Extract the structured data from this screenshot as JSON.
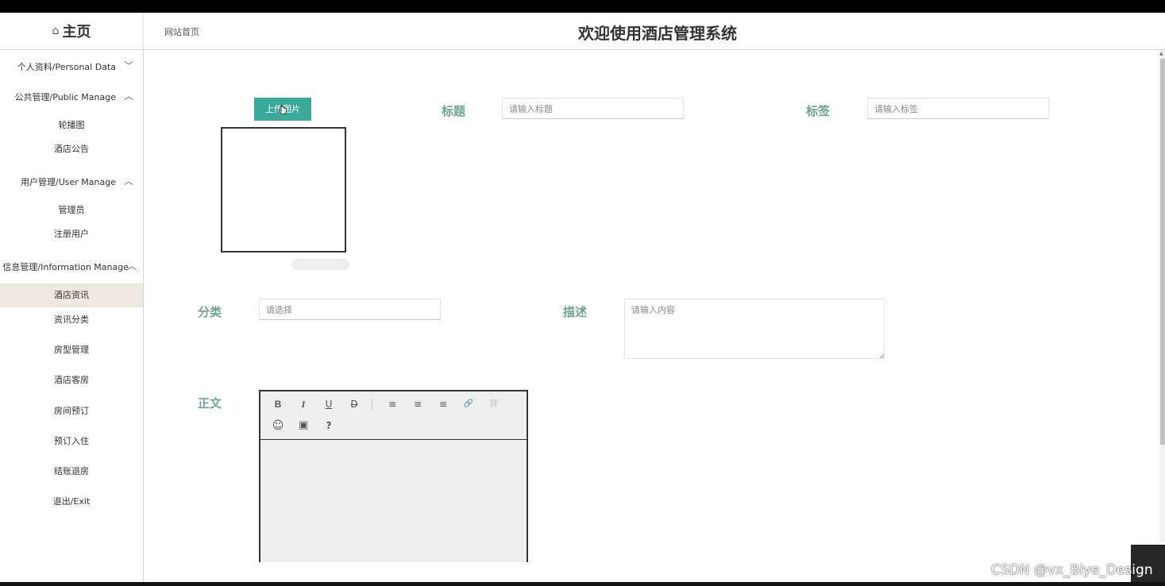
{
  "header": {
    "brand_icon": "home-icon",
    "brand": "主页",
    "breadcrumb": "网站首页",
    "title": "欢迎使用酒店管理系统"
  },
  "sidebar": {
    "groups": [
      {
        "label": "个人资料/Personal Data",
        "chevron": "﹀"
      },
      {
        "label": "公共管理/Public Manage",
        "chevron": "︿"
      },
      {
        "label": "用户管理/User Manage",
        "chevron": "︿"
      },
      {
        "label": "信息管理/Information Manage",
        "chevron": "︿"
      }
    ],
    "items": [
      "轮播图",
      "酒店公告",
      "管理员",
      "注册用户",
      "酒店资讯",
      "资讯分类",
      "房型管理",
      "酒店客房",
      "房间预订",
      "预订入住",
      "结账退房",
      "退出/Exit"
    ],
    "active_item": "酒店资讯",
    "active_color": "#efe8dc"
  },
  "form": {
    "upload_button": "上传图片",
    "title_label": "标题",
    "title_placeholder": "请输入标题",
    "tag_label": "标签",
    "tag_placeholder": "请输入标签",
    "category_label": "分类",
    "category_placeholder": "请选择",
    "desc_label": "描述",
    "desc_placeholder": "请输入内容",
    "body_label": "正文",
    "label_color": "#6da58f",
    "button_color": "#3aa89b"
  },
  "editor": {
    "toolbar": [
      {
        "name": "bold-icon",
        "glyph": "B"
      },
      {
        "name": "italic-icon",
        "glyph": "I"
      },
      {
        "name": "underline-icon",
        "glyph": "U"
      },
      {
        "name": "strikethrough-icon",
        "glyph": "D"
      },
      {
        "name": "align-left-icon",
        "glyph": "≡"
      },
      {
        "name": "align-center-icon",
        "glyph": "≡"
      },
      {
        "name": "align-right-icon",
        "glyph": "≡"
      },
      {
        "name": "link-icon",
        "glyph": "🔗"
      },
      {
        "name": "unlink-icon",
        "glyph": "⛓"
      },
      {
        "name": "emoji-icon",
        "glyph": "☺"
      },
      {
        "name": "image-icon",
        "glyph": "▣"
      },
      {
        "name": "help-icon",
        "glyph": "?"
      }
    ]
  },
  "watermark": "CSDN @vx_Biye_Design"
}
